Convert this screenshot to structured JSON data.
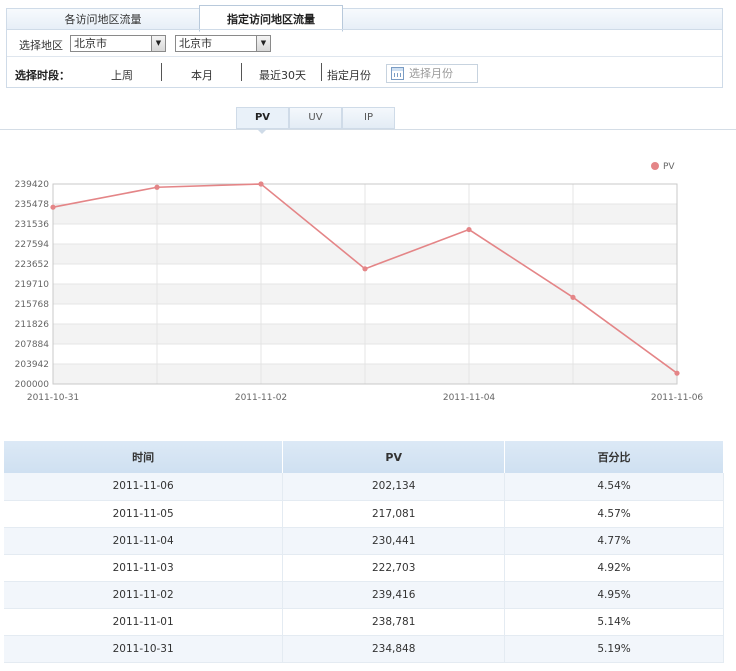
{
  "tabs": {
    "tab1": "各访问地区流量",
    "tab2": "指定访问地区流量"
  },
  "filter": {
    "region_label": "选择地区",
    "province": "北京市",
    "city": "北京市",
    "period_label": "选择时段：",
    "period_last_week": "上周",
    "period_this_month": "本月",
    "period_last30": "最近30天",
    "period_month": "指定月份",
    "month_placeholder": "选择月份"
  },
  "metric_tabs": [
    "PV",
    "UV",
    "IP"
  ],
  "chart_data": {
    "type": "line",
    "legend": "PV",
    "legend_position": "top-right",
    "color": "#e48587",
    "x": [
      "2011-10-31",
      "2011-11-01",
      "2011-11-02",
      "2011-11-03",
      "2011-11-04",
      "2011-11-05",
      "2011-11-06"
    ],
    "x_tick_labels": [
      "2011-10-31",
      "2011-11-02",
      "2011-11-04",
      "2011-11-06"
    ],
    "values": [
      234848,
      238781,
      239416,
      222703,
      230441,
      217081,
      202134
    ],
    "y_ticks": [
      200000,
      203942,
      207884,
      211826,
      215768,
      219710,
      223652,
      227594,
      231536,
      235478,
      239420
    ],
    "ylim": [
      200000,
      239420
    ],
    "grid": true
  },
  "table": {
    "headers": [
      "时间",
      "PV",
      "百分比"
    ],
    "rows": [
      [
        "2011-11-06",
        "202,134",
        "4.54%"
      ],
      [
        "2011-11-05",
        "217,081",
        "4.57%"
      ],
      [
        "2011-11-04",
        "230,441",
        "4.77%"
      ],
      [
        "2011-11-03",
        "222,703",
        "4.92%"
      ],
      [
        "2011-11-02",
        "239,416",
        "4.95%"
      ],
      [
        "2011-11-01",
        "238,781",
        "5.14%"
      ],
      [
        "2011-10-31",
        "234,848",
        "5.19%"
      ]
    ]
  }
}
